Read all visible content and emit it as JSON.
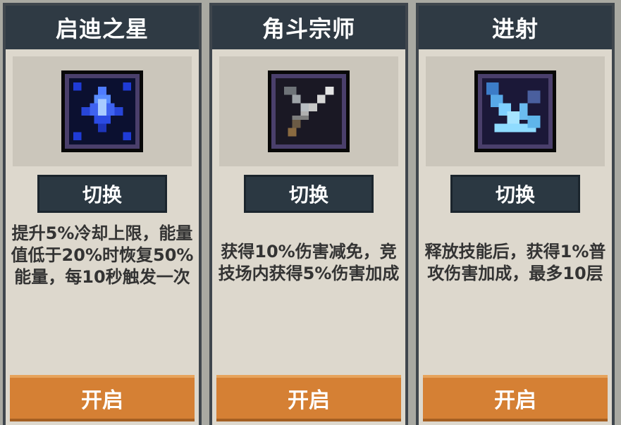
{
  "cards": [
    {
      "title": "启迪之星",
      "icon": "blue-crystal-star-icon",
      "switch_label": "切换",
      "description": "提升5%冷却上限，能量值低于20%时恢复50%能量，每10秒触发一次",
      "open_label": "开启"
    },
    {
      "title": "角斗宗师",
      "icon": "crossed-swords-icon",
      "switch_label": "切换",
      "description": "获得10%伤害减免，竞技场内获得5%伤害加成",
      "open_label": "开启"
    },
    {
      "title": "进射",
      "icon": "ice-shard-burst-icon",
      "switch_label": "切换",
      "description": "释放技能后，获得1%普攻伤害加成，最多10层",
      "open_label": "开启"
    }
  ],
  "colors": {
    "header_bg": "#2f3a44",
    "card_bg": "#ddd8cd",
    "open_button": "#d58034",
    "switch_button": "#2b3842"
  }
}
